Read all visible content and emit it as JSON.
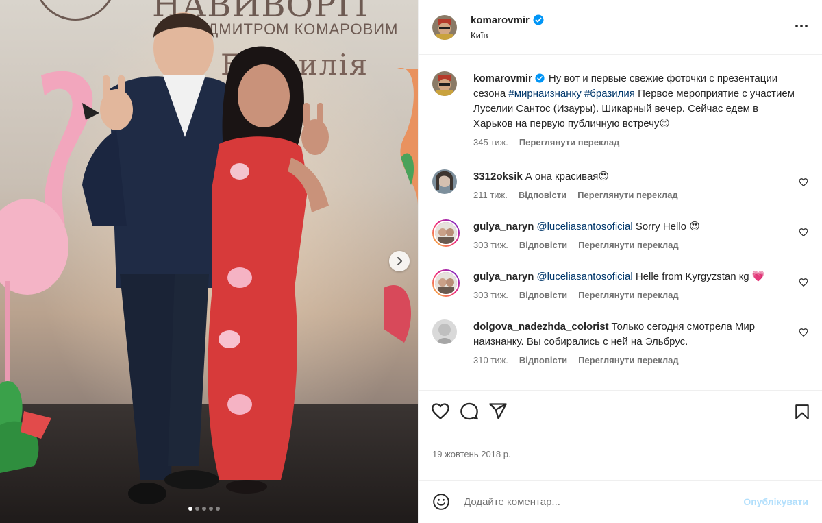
{
  "photo": {
    "backdrop_title": "НАВИВОРІТ",
    "backdrop_subtitle": "З ДМИТРОМ КОМАРОВИМ",
    "backdrop_country": "Бразилія",
    "carousel_total": 5,
    "carousel_active": 1
  },
  "header": {
    "username": "komarovmir",
    "location": "Київ",
    "verified": true
  },
  "caption": {
    "username": "komarovmir",
    "text_before": "Ну вот и первые свежие фоточки с презентации сезона ",
    "hashtag1": "#мирнаизнанку",
    "hashtag2": "#бразилия",
    "text_after": " Первое мероприятие с участием Луселии Сантос (Изауры). Шикарный вечер. Сейчас едем в Харьков на первую публичную встречу😊",
    "time": "345 тиж.",
    "translate": "Переглянути переклад"
  },
  "comments": [
    {
      "username": "3312oksik",
      "mention": "",
      "text": "А она красивая😍",
      "time": "211 тиж.",
      "reply": "Відповісти",
      "translate": "Переглянути переклад"
    },
    {
      "username": "gulya_naryn",
      "mention": "@luceliasantosoficial",
      "text": " Sorry Hello 😍",
      "time": "303 тиж.",
      "reply": "Відповісти",
      "translate": "Переглянути переклад"
    },
    {
      "username": "gulya_naryn",
      "mention": "@luceliasantosoficial",
      "text": " Helle from Kyrgyzstan кg 💗",
      "time": "303 тиж.",
      "reply": "Відповісти",
      "translate": "Переглянути переклад"
    },
    {
      "username": "dolgova_nadezhda_colorist",
      "mention": "",
      "text": "Только сегодня смотрела Мир наизнанку. Вы собирались с ней на Эльбрус.",
      "time": "310 тиж.",
      "reply": "Відповісти",
      "translate": "Переглянути переклад"
    }
  ],
  "footer": {
    "date": "19 жовтень 2018 р.",
    "comment_placeholder": "Додайте коментар...",
    "publish": "Опублікувати"
  },
  "colors": {
    "verified": "#0095f6",
    "link": "#00376b",
    "publish_disabled": "#b2dffc",
    "secondary_text": "#737373"
  }
}
